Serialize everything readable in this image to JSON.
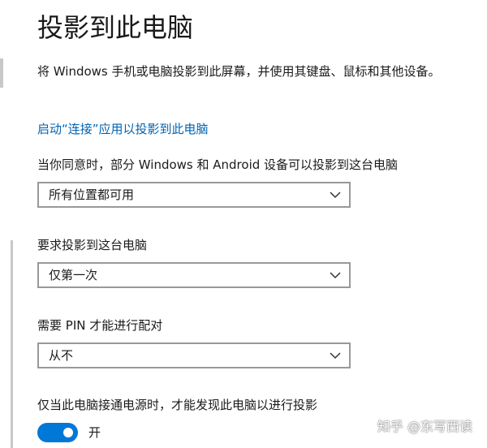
{
  "page": {
    "title": "投影到此电脑",
    "description": "将 Windows 手机或电脑投影到此屏幕，并使用其键盘、鼠标和其他设备。",
    "connect_link": "启动“连接”应用以投影到此电脑"
  },
  "settings": {
    "availability": {
      "label": "当你同意时，部分 Windows 和 Android 设备可以投影到这台电脑",
      "value": "所有位置都可用"
    },
    "ask_to_project": {
      "label": "要求投影到这台电脑",
      "value": "仅第一次"
    },
    "pin_required": {
      "label": "需要 PIN 才能进行配对",
      "value": "从不"
    },
    "power_only": {
      "label": "仅当此电脑接通电源时，才能发现此电脑以进行投影",
      "state": "开",
      "on": true
    }
  },
  "watermark": {
    "text": "知乎 @东写西读"
  },
  "colors": {
    "accent": "#0078d7",
    "link": "#0063b1",
    "border": "#999999"
  },
  "icons": {
    "dropdown": "chevron-down-icon"
  }
}
